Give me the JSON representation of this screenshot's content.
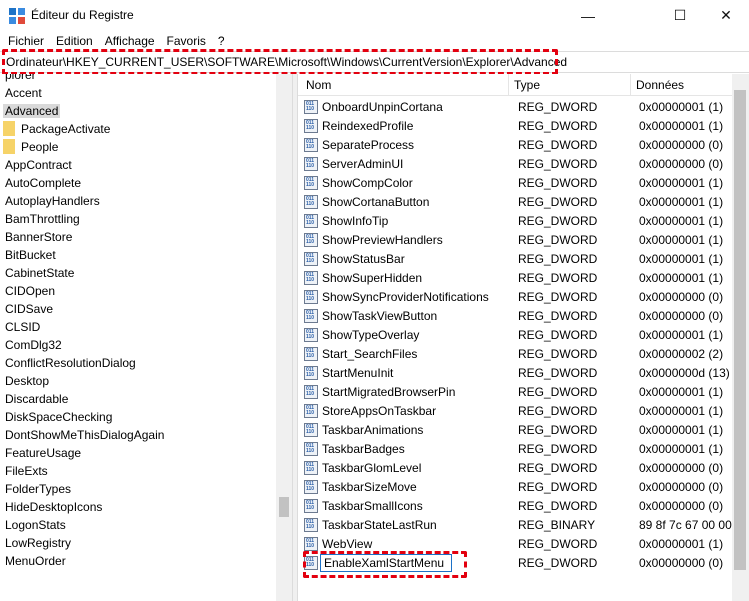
{
  "window": {
    "title": "Éditeur du Registre",
    "icon": "regedit-icon"
  },
  "window_buttons": {
    "minimize": "—",
    "maximize": "☐",
    "close": "✕"
  },
  "menu": [
    "Fichier",
    "Edition",
    "Affichage",
    "Favoris",
    "?"
  ],
  "address": "Ordinateur\\HKEY_CURRENT_USER\\SOFTWARE\\Microsoft\\Windows\\CurrentVersion\\Explorer\\Advanced",
  "tree": [
    {
      "label": "plorer",
      "folder": false,
      "selected": false,
      "indent": 0
    },
    {
      "label": "Accent",
      "folder": false,
      "selected": false,
      "indent": 0
    },
    {
      "label": "Advanced",
      "folder": false,
      "selected": true,
      "indent": 0
    },
    {
      "label": "PackageActivate",
      "folder": true,
      "selected": false,
      "indent": 1
    },
    {
      "label": "People",
      "folder": true,
      "selected": false,
      "indent": 1
    },
    {
      "label": "AppContract",
      "folder": false,
      "selected": false,
      "indent": 0
    },
    {
      "label": "AutoComplete",
      "folder": false,
      "selected": false,
      "indent": 0
    },
    {
      "label": "AutoplayHandlers",
      "folder": false,
      "selected": false,
      "indent": 0
    },
    {
      "label": "BamThrottling",
      "folder": false,
      "selected": false,
      "indent": 0
    },
    {
      "label": "BannerStore",
      "folder": false,
      "selected": false,
      "indent": 0
    },
    {
      "label": "BitBucket",
      "folder": false,
      "selected": false,
      "indent": 0
    },
    {
      "label": "CabinetState",
      "folder": false,
      "selected": false,
      "indent": 0
    },
    {
      "label": "CIDOpen",
      "folder": false,
      "selected": false,
      "indent": 0
    },
    {
      "label": "CIDSave",
      "folder": false,
      "selected": false,
      "indent": 0
    },
    {
      "label": "CLSID",
      "folder": false,
      "selected": false,
      "indent": 0
    },
    {
      "label": "ComDlg32",
      "folder": false,
      "selected": false,
      "indent": 0
    },
    {
      "label": "ConflictResolutionDialog",
      "folder": false,
      "selected": false,
      "indent": 0
    },
    {
      "label": "Desktop",
      "folder": false,
      "selected": false,
      "indent": 0
    },
    {
      "label": "Discardable",
      "folder": false,
      "selected": false,
      "indent": 0
    },
    {
      "label": "DiskSpaceChecking",
      "folder": false,
      "selected": false,
      "indent": 0
    },
    {
      "label": "DontShowMeThisDialogAgain",
      "folder": false,
      "selected": false,
      "indent": 0
    },
    {
      "label": "FeatureUsage",
      "folder": false,
      "selected": false,
      "indent": 0
    },
    {
      "label": "FileExts",
      "folder": false,
      "selected": false,
      "indent": 0
    },
    {
      "label": "FolderTypes",
      "folder": false,
      "selected": false,
      "indent": 0
    },
    {
      "label": "HideDesktopIcons",
      "folder": false,
      "selected": false,
      "indent": 0
    },
    {
      "label": "LogonStats",
      "folder": false,
      "selected": false,
      "indent": 0
    },
    {
      "label": "LowRegistry",
      "folder": false,
      "selected": false,
      "indent": 0
    },
    {
      "label": "MenuOrder",
      "folder": false,
      "selected": false,
      "indent": 0
    }
  ],
  "columns": {
    "name": "Nom",
    "type": "Type",
    "data": "Données"
  },
  "values": [
    {
      "name": "OnboardUnpinCortana",
      "type": "REG_DWORD",
      "data": "0x00000001 (1)"
    },
    {
      "name": "ReindexedProfile",
      "type": "REG_DWORD",
      "data": "0x00000001 (1)"
    },
    {
      "name": "SeparateProcess",
      "type": "REG_DWORD",
      "data": "0x00000000 (0)"
    },
    {
      "name": "ServerAdminUI",
      "type": "REG_DWORD",
      "data": "0x00000000 (0)"
    },
    {
      "name": "ShowCompColor",
      "type": "REG_DWORD",
      "data": "0x00000001 (1)"
    },
    {
      "name": "ShowCortanaButton",
      "type": "REG_DWORD",
      "data": "0x00000001 (1)"
    },
    {
      "name": "ShowInfoTip",
      "type": "REG_DWORD",
      "data": "0x00000001 (1)"
    },
    {
      "name": "ShowPreviewHandlers",
      "type": "REG_DWORD",
      "data": "0x00000001 (1)"
    },
    {
      "name": "ShowStatusBar",
      "type": "REG_DWORD",
      "data": "0x00000001 (1)"
    },
    {
      "name": "ShowSuperHidden",
      "type": "REG_DWORD",
      "data": "0x00000001 (1)"
    },
    {
      "name": "ShowSyncProviderNotifications",
      "type": "REG_DWORD",
      "data": "0x00000000 (0)"
    },
    {
      "name": "ShowTaskViewButton",
      "type": "REG_DWORD",
      "data": "0x00000000 (0)"
    },
    {
      "name": "ShowTypeOverlay",
      "type": "REG_DWORD",
      "data": "0x00000001 (1)"
    },
    {
      "name": "Start_SearchFiles",
      "type": "REG_DWORD",
      "data": "0x00000002 (2)"
    },
    {
      "name": "StartMenuInit",
      "type": "REG_DWORD",
      "data": "0x0000000d (13)"
    },
    {
      "name": "StartMigratedBrowserPin",
      "type": "REG_DWORD",
      "data": "0x00000001 (1)"
    },
    {
      "name": "StoreAppsOnTaskbar",
      "type": "REG_DWORD",
      "data": "0x00000001 (1)"
    },
    {
      "name": "TaskbarAnimations",
      "type": "REG_DWORD",
      "data": "0x00000001 (1)"
    },
    {
      "name": "TaskbarBadges",
      "type": "REG_DWORD",
      "data": "0x00000001 (1)"
    },
    {
      "name": "TaskbarGlomLevel",
      "type": "REG_DWORD",
      "data": "0x00000000 (0)"
    },
    {
      "name": "TaskbarSizeMove",
      "type": "REG_DWORD",
      "data": "0x00000000 (0)"
    },
    {
      "name": "TaskbarSmallIcons",
      "type": "REG_DWORD",
      "data": "0x00000000 (0)"
    },
    {
      "name": "TaskbarStateLastRun",
      "type": "REG_BINARY",
      "data": "89 8f 7c 67 00 00 00 ("
    },
    {
      "name": "WebView",
      "type": "REG_DWORD",
      "data": "0x00000001 (1)"
    },
    {
      "name": "EnableXamlStartMenu",
      "type": "REG_DWORD",
      "data": "0x00000000 (0)",
      "editing": true
    }
  ],
  "highlight_color": "#e3000f",
  "selection_color": "#d9d9d9"
}
